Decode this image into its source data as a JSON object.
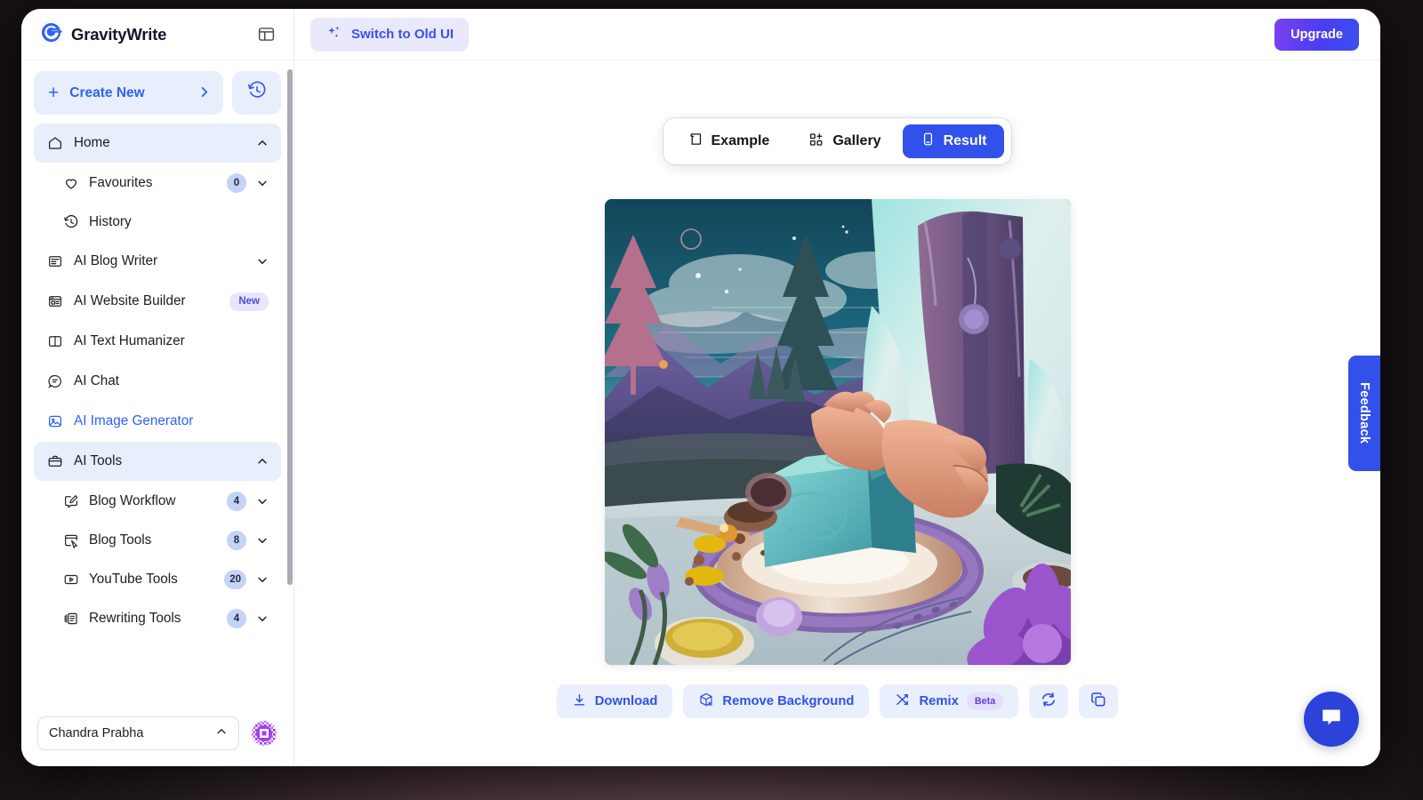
{
  "app": {
    "brand_name": "GravityWrite",
    "panel_toggle_icon": "panel-layout-icon"
  },
  "sidebar": {
    "create_new": {
      "label": "Create New",
      "plus_icon": "plus-icon",
      "chevron_icon": "chevron-right-icon"
    },
    "history_button_icon": "history-clock-icon",
    "nav": [
      {
        "label": "Home",
        "icon": "home-icon",
        "state": "active",
        "chevron": "chevron-up-icon"
      },
      {
        "label": "Favourites",
        "icon": "heart-icon",
        "sub": true,
        "badge": "0",
        "chevron": "chevron-down-icon"
      },
      {
        "label": "History",
        "icon": "history-clock-icon",
        "sub": true
      },
      {
        "label": "AI Blog Writer",
        "icon": "article-icon",
        "chevron": "chevron-down-icon"
      },
      {
        "label": "AI Website Builder",
        "icon": "browser-icon",
        "tag": "New"
      },
      {
        "label": "AI Text Humanizer",
        "icon": "book-open-icon"
      },
      {
        "label": "AI Chat",
        "icon": "chat-circle-icon"
      },
      {
        "label": "AI Image Generator",
        "icon": "image-icon",
        "state": "accent"
      },
      {
        "label": "AI Tools",
        "icon": "briefcase-icon",
        "state": "active",
        "chevron": "chevron-up-icon"
      },
      {
        "label": "Blog Workflow",
        "icon": "pencil-square-icon",
        "sub": true,
        "badge": "4",
        "chevron": "chevron-down-icon"
      },
      {
        "label": "Blog Tools",
        "icon": "window-cursor-icon",
        "sub": true,
        "badge": "8",
        "chevron": "chevron-down-icon"
      },
      {
        "label": "YouTube Tools",
        "icon": "play-rect-icon",
        "sub": true,
        "badge": "20",
        "chevron": "chevron-down-icon"
      },
      {
        "label": "Rewriting Tools",
        "icon": "pages-icon",
        "sub": true,
        "badge": "4",
        "chevron": "chevron-down-icon"
      }
    ],
    "footer": {
      "user_name": "Chandra Prabha",
      "chevron_icon": "chevron-up-icon",
      "avatar_icon": "identicon-avatar"
    }
  },
  "topbar": {
    "switch_old_ui": {
      "label": "Switch to Old UI",
      "icon": "sparkles-icon"
    },
    "upgrade_label": "Upgrade"
  },
  "tabs": [
    {
      "label": "Example",
      "icon": "book-icon",
      "active": false
    },
    {
      "label": "Gallery",
      "icon": "grid-plus-icon",
      "active": false
    },
    {
      "label": "Result",
      "icon": "device-icon",
      "active": true
    }
  ],
  "result": {
    "image_alt": "Illustrated dusk scene: hands placing a swirled teal soap bar on a round wooden board ringed with lavender, mountains and pink clouds behind",
    "actions": [
      {
        "label": "Download",
        "icon": "download-icon"
      },
      {
        "label": "Remove Background",
        "icon": "remove-bg-icon"
      },
      {
        "label": "Remix",
        "icon": "shuffle-icon",
        "tag": "Beta"
      }
    ],
    "icon_actions": [
      {
        "icon": "refresh-icon"
      },
      {
        "icon": "copy-icon"
      }
    ]
  },
  "feedback": {
    "label": "Feedback"
  },
  "chat": {
    "icon": "chat-bubble-icon"
  },
  "colors": {
    "accent_blue": "#3251eb",
    "link_blue": "#2f62f3",
    "soft_blue_bg": "#e8eefb",
    "upgrade_gradient_start": "#7a41f0",
    "upgrade_gradient_end": "#3b4ef0",
    "badge_blue": "#c3d4f8",
    "new_tag_bg": "#e7e6fd",
    "beta_tag_bg": "#e5defb",
    "backdrop": "#1a1416"
  }
}
